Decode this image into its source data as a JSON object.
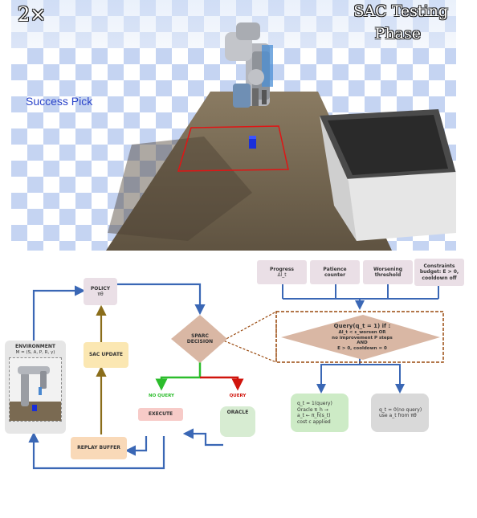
{
  "simulation": {
    "speed_label": "2×",
    "phase_line1": "SAC Testing",
    "phase_line2": "Phase",
    "status_text": "Success Pick"
  },
  "diagram": {
    "policy": {
      "label": "POLICY",
      "symbol": "πθ"
    },
    "sac_update": "SAC UPDATE",
    "replay_buffer": "REPLAY BUFFER",
    "environment": {
      "title": "ENVIRONMENT",
      "subtitle": "M = (S, A, P, R, γ)"
    },
    "sparc": {
      "line1": "SPARC",
      "line2": "DECISION"
    },
    "no_query_label": "NO QUERY",
    "query_label": "QUERY",
    "execute": "EXECUTE",
    "oracle": "ORACLE",
    "signals": [
      {
        "line1": "Progress",
        "line2": "Δl_t"
      },
      {
        "line1": "Patience",
        "line2": "counter"
      },
      {
        "line1": "Worsening",
        "line2": "threshold"
      },
      {
        "line1": "Constraints",
        "line2": "budget: E > 0,",
        "line3": "cooldown off"
      }
    ],
    "condition": {
      "line1": "Query(q_t = 1) if :",
      "line2": "Δl_t < ε_worsen OR",
      "line3": "no improvement P steps",
      "line4": "AND",
      "line5": "E > 0, cooldown = 0"
    },
    "query_outcome": {
      "line1": "q_t = 1(query)",
      "line2": "Oracle π_h →",
      "line3": "a_t ← π_h(s_t)",
      "line4": "cost c applied"
    },
    "no_query_outcome": {
      "line1": "q_t = 0(no query)",
      "line2": "use a_t from πθ"
    }
  },
  "colors": {
    "arrow_blue": "#3a67b5",
    "arrow_olive": "#8a6d1a",
    "arrow_green": "#2cbd2c",
    "arrow_red": "#d0140c",
    "dashed_brown": "#9a4a0f",
    "diamond_fill": "#d9b7a4",
    "policy_fill": "#eadfe6",
    "sac_fill": "#fbe7b2",
    "replay_fill": "#f9d9b8",
    "execute_fill": "#f7cbc8",
    "oracle_fill": "#d7ecd2",
    "query_outcome_fill": "#cdebc6",
    "no_query_outcome_fill": "#d9d9d9",
    "signal_fill": "#eadfe6"
  }
}
